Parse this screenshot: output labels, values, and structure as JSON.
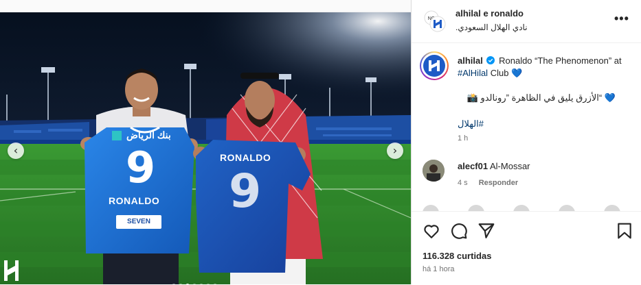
{
  "post": {
    "media": {
      "shirt_left_sponsor": "بنك الرياض",
      "shirt_left_number": "9",
      "shirt_left_name": "RONALDO",
      "shirt_left_badge": "SEVEN",
      "shirt_right_name": "RONALDO",
      "shirt_right_number": "9",
      "carousel_prev": "‹",
      "carousel_next": "›",
      "carousel_dot_count": 7,
      "carousel_active_index": 2,
      "colors": {
        "jersey_blue": "#1f6fd4",
        "pitch_green": "#2f8a2e"
      }
    }
  },
  "header": {
    "username": "alhilal e ronaldo",
    "subtitle": "نادي الهلال السعودي.",
    "more_label": "•••"
  },
  "caption": {
    "username": "alhilal",
    "text_before_link": "Ronaldo “The Phenomenon” at ",
    "link": "#AlHilal",
    "text_after_link": " Club 💙",
    "arabic_line": "💙 “الأزرق يليق في الظاهرة ”رونالدو 📸",
    "hashtag": "#الهلال",
    "time": "1 h"
  },
  "comment": {
    "username": "alecf01",
    "text": "Al-Mossar",
    "time": "4 s",
    "reply_label": "Responder"
  },
  "footer": {
    "likes": "116.328 curtidas",
    "posted": "há 1 hora"
  },
  "icons": [
    "like-icon",
    "comment-icon",
    "share-icon",
    "save-icon",
    "verified-icon",
    "more-icon"
  ]
}
